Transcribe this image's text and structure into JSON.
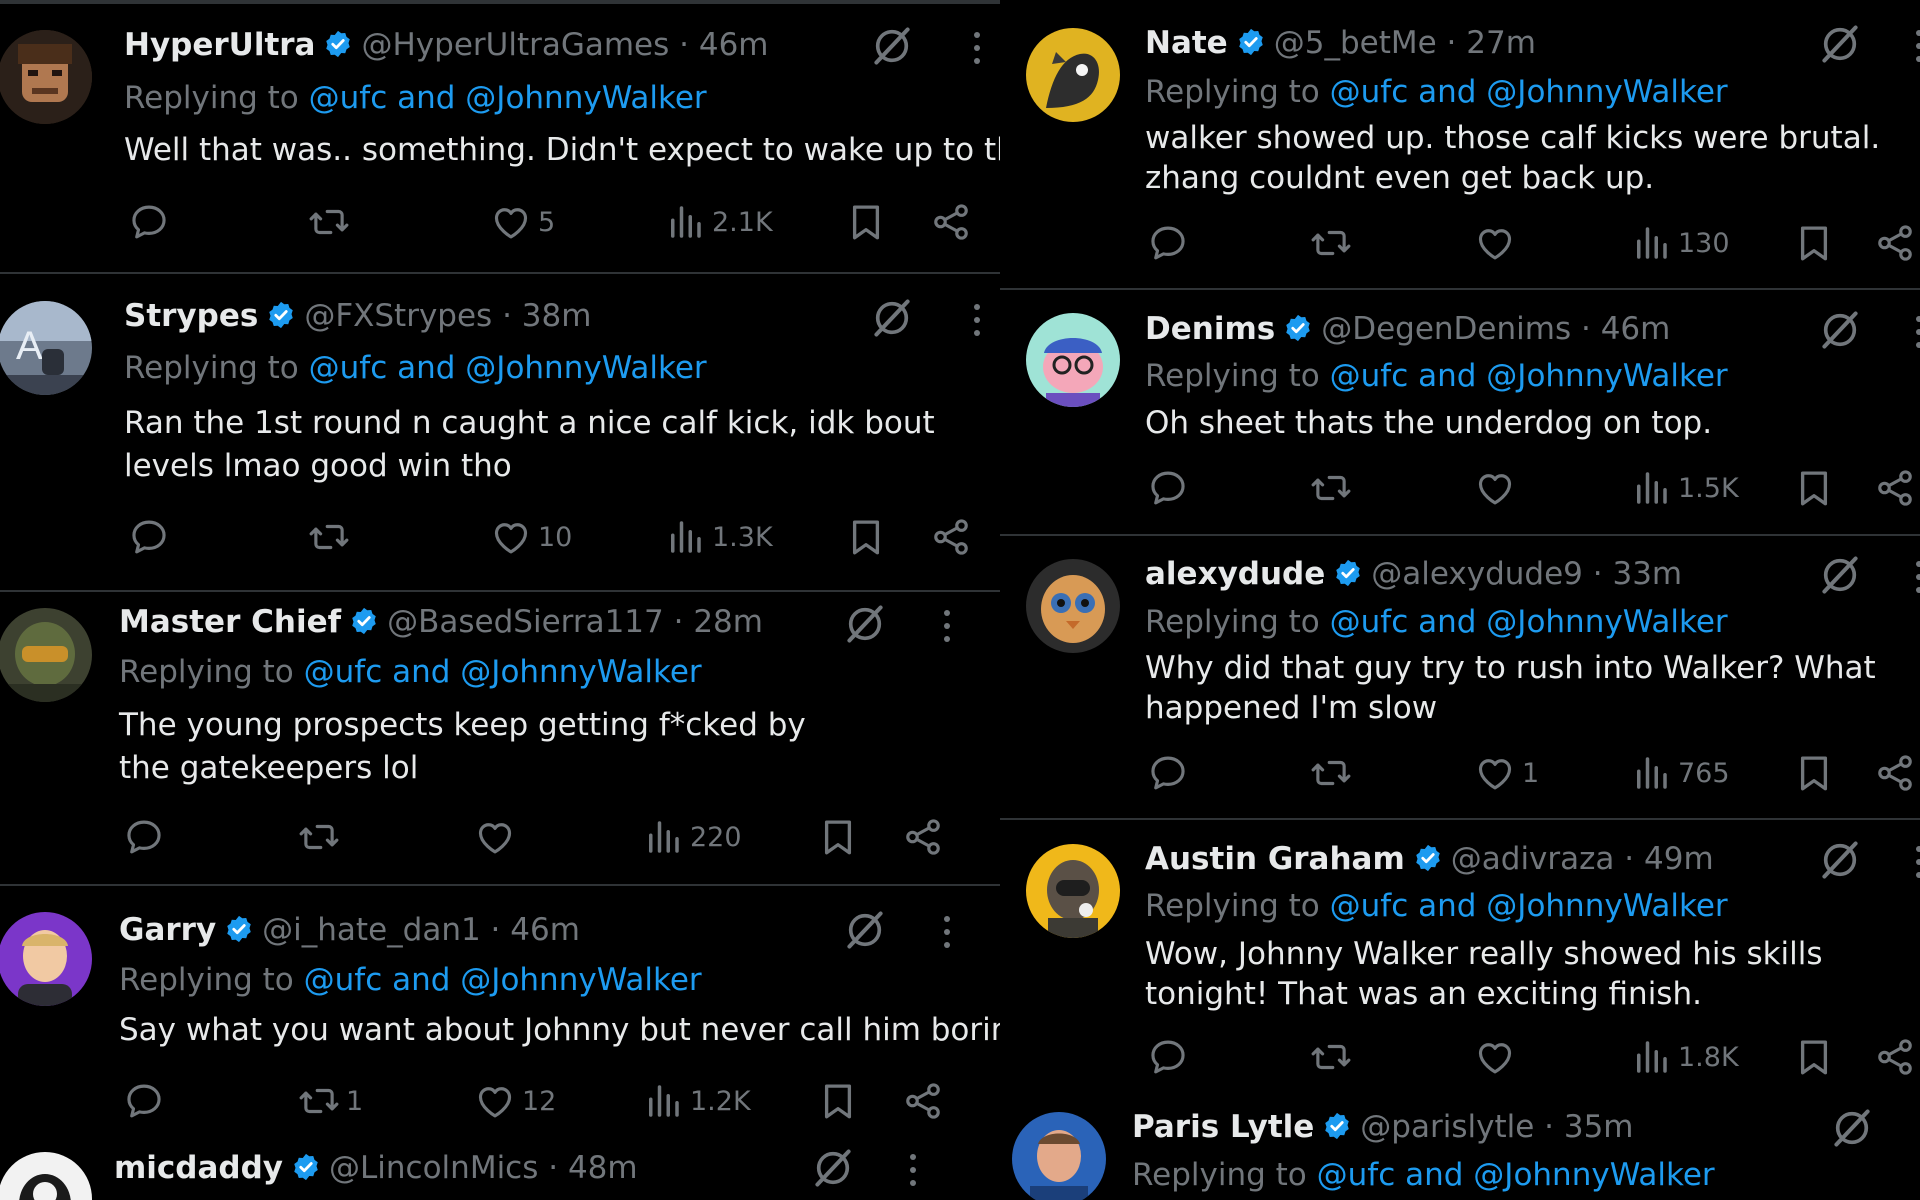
{
  "reply_prefix": "Replying to",
  "mentions": {
    "ufc": "@ufc",
    "and": "and",
    "walker": "@JohnnyWalker"
  },
  "sep": "·",
  "colors": {
    "background": "#000000",
    "text": "#e7e9ea",
    "muted": "#71767b",
    "link": "#1d9bf0",
    "verified": "#1d9bf0",
    "divider": "#2f3336"
  },
  "icons": {
    "reply": "reply-icon",
    "retweet": "retweet-icon",
    "like": "heart-icon",
    "views": "views-icon",
    "bookmark": "bookmark-icon",
    "share": "share-icon",
    "grok": "grok-icon",
    "more": "more-icon"
  },
  "left": [
    {
      "name": "HyperUltra",
      "handle": "@HyperUltraGames",
      "time": "46m",
      "text": "Well that was.. something.  Didn't expect to wake up to this.",
      "replies": "",
      "retweets": "",
      "likes": "5",
      "views": "2.1K"
    },
    {
      "name": "Strypes",
      "handle": "@FXStrypes",
      "time": "38m",
      "text": "Ran the 1st round n caught a nice calf kick, idk bout levels lmao good win tho",
      "replies": "",
      "retweets": "",
      "likes": "10",
      "views": "1.3K"
    },
    {
      "name": "Master Chief",
      "handle": "@BasedSierra117",
      "time": "28m",
      "text": "The young prospects keep getting f*cked by the gatekeepers lol",
      "replies": "",
      "retweets": "",
      "likes": "",
      "views": "220"
    },
    {
      "name": "Garry",
      "handle": "@i_hate_dan1",
      "time": "46m",
      "text": "Say what you want about Johnny but never call him boring.",
      "replies": "",
      "retweets": "1",
      "likes": "12",
      "views": "1.2K"
    },
    {
      "name": "micdaddy",
      "handle": "@LincolnMics",
      "time": "48m"
    }
  ],
  "right": [
    {
      "name": "Nate",
      "handle": "@5_betMe",
      "time": "27m",
      "text": "walker showed up. those calf kicks were brutal. zhang couldnt even get back up.",
      "replies": "",
      "retweets": "",
      "likes": "",
      "views": "130"
    },
    {
      "name": "Denims",
      "handle": "@DegenDenims",
      "time": "46m",
      "text": "Oh sheet thats the underdog on top.",
      "replies": "",
      "retweets": "",
      "likes": "",
      "views": "1.5K"
    },
    {
      "name": "alexydude",
      "handle": "@alexydude9",
      "time": "33m",
      "text": "Why did that guy try to rush into Walker? What happened I'm slow",
      "replies": "",
      "retweets": "",
      "likes": "1",
      "views": "765"
    },
    {
      "name": "Austin Graham",
      "handle": "@adivraza",
      "time": "49m",
      "text": "Wow, Johnny Walker really showed his skills tonight! That was an exciting finish.",
      "replies": "",
      "retweets": "",
      "likes": "",
      "views": "1.8K"
    },
    {
      "name": "Paris Lytle",
      "handle": "@parislytle",
      "time": "35m"
    }
  ]
}
